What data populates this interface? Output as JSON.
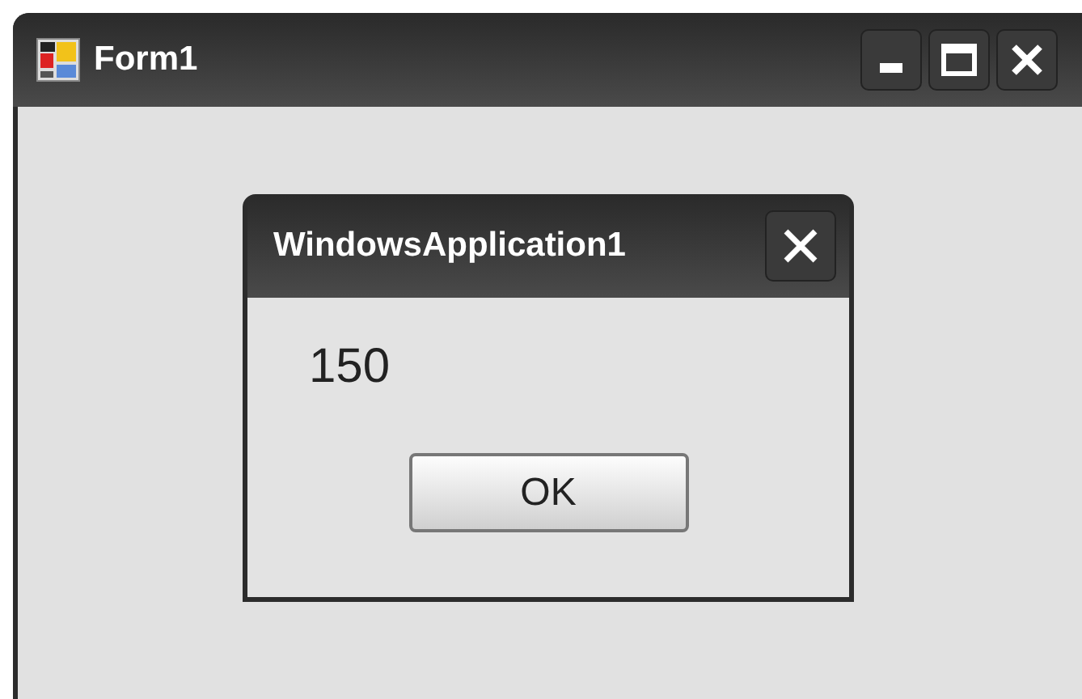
{
  "window": {
    "title": "Form1"
  },
  "dialog": {
    "title": "WindowsApplication1",
    "message": "150",
    "buttons": [
      "OK"
    ]
  }
}
